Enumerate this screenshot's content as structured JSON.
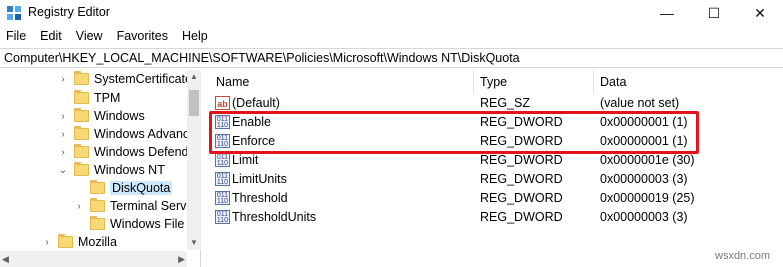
{
  "window": {
    "title": "Registry Editor",
    "minimize_glyph": "—",
    "maximize_glyph": "☐",
    "close_glyph": "✕"
  },
  "menu": [
    "File",
    "Edit",
    "View",
    "Favorites",
    "Help"
  ],
  "address": "Computer\\HKEY_LOCAL_MACHINE\\SOFTWARE\\Policies\\Microsoft\\Windows NT\\DiskQuota",
  "tree": [
    {
      "label": "SystemCertificate",
      "chevron": "›"
    },
    {
      "label": "TPM",
      "chevron": ""
    },
    {
      "label": "Windows",
      "chevron": "›"
    },
    {
      "label": "Windows Advanc",
      "chevron": "›"
    },
    {
      "label": "Windows Defende",
      "chevron": "›"
    },
    {
      "label": "Windows NT",
      "chevron": "⌄"
    },
    {
      "label": "DiskQuota",
      "chevron": "",
      "selected": true
    },
    {
      "label": "Terminal Servic",
      "chevron": "›"
    },
    {
      "label": "Windows File F",
      "chevron": ""
    },
    {
      "label": "Mozilla",
      "chevron": "›"
    }
  ],
  "columns": {
    "name": "Name",
    "type": "Type",
    "data": "Data"
  },
  "values": [
    {
      "name": "(Default)",
      "type": "REG_SZ",
      "data": "(value not set)",
      "icon": "string-value-icon",
      "glyph": "ab"
    },
    {
      "name": "Enable",
      "type": "REG_DWORD",
      "data": "0x00000001 (1)",
      "icon": "dword-value-icon",
      "glyph": "011 110"
    },
    {
      "name": "Enforce",
      "type": "REG_DWORD",
      "data": "0x00000001 (1)",
      "icon": "dword-value-icon",
      "glyph": "011 110"
    },
    {
      "name": "Limit",
      "type": "REG_DWORD",
      "data": "0x0000001e (30)",
      "icon": "dword-value-icon",
      "glyph": "011 110"
    },
    {
      "name": "LimitUnits",
      "type": "REG_DWORD",
      "data": "0x00000003 (3)",
      "icon": "dword-value-icon",
      "glyph": "011 110"
    },
    {
      "name": "Threshold",
      "type": "REG_DWORD",
      "data": "0x00000019 (25)",
      "icon": "dword-value-icon",
      "glyph": "011 110"
    },
    {
      "name": "ThresholdUnits",
      "type": "REG_DWORD",
      "data": "0x00000003 (3)",
      "icon": "dword-value-icon",
      "glyph": "011 110"
    }
  ],
  "scroll": {
    "up": "▲",
    "down": "▼",
    "left": "◀",
    "right": "▶"
  },
  "watermark": "wsxdn.com",
  "colors": {
    "highlight": "#e3131b",
    "selection": "#cce8ff",
    "folder": "#f8d775"
  }
}
